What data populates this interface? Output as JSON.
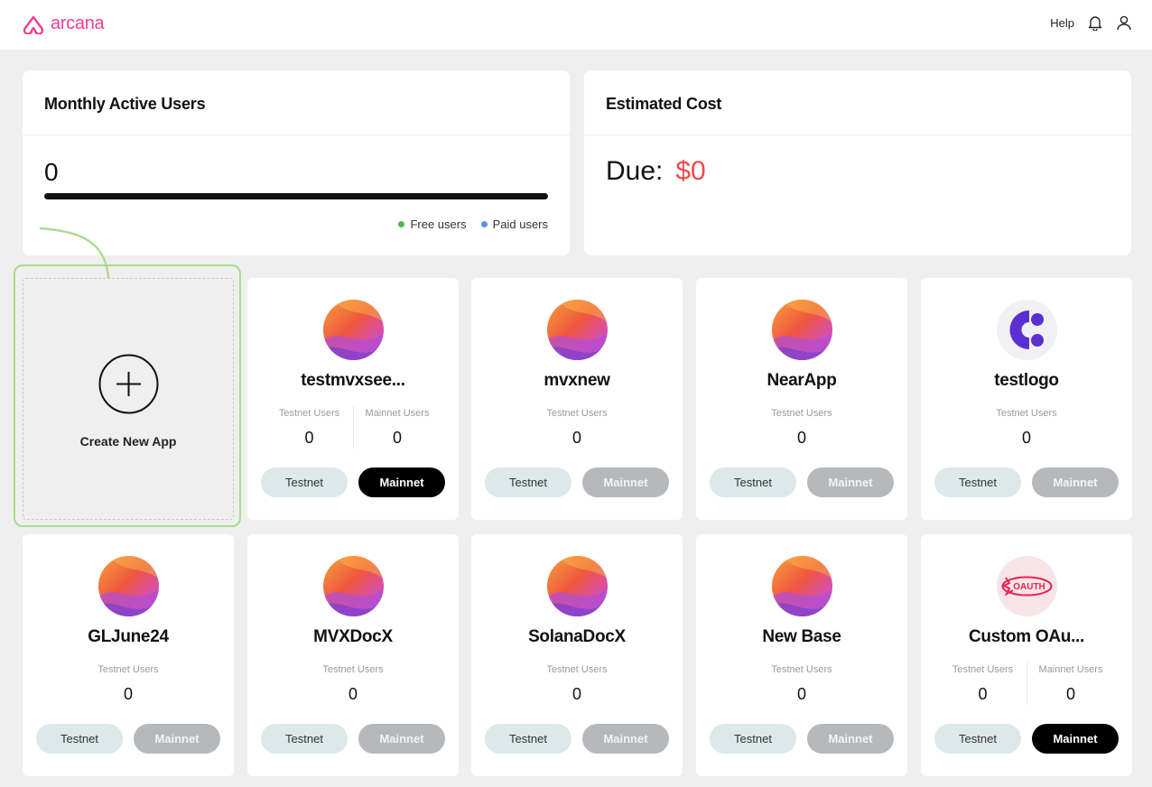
{
  "header": {
    "brand": "arcana",
    "help_label": "Help",
    "brand_color": "#ef3f8f"
  },
  "mau": {
    "title": "Monthly Active Users",
    "count": "0",
    "legend_free": "Free users",
    "legend_paid": "Paid users",
    "free_color": "#4cbb47",
    "paid_color": "#5b8def"
  },
  "cost": {
    "title": "Estimated Cost",
    "due_label": "Due:",
    "due_value": "$0"
  },
  "create": {
    "label": "Create New App"
  },
  "apps": [
    {
      "name": "testmvxsee...",
      "logo": "gradient",
      "testnet_label": "Testnet Users",
      "testnet_users": "0",
      "mainnet_label": "Mainnet Users",
      "mainnet_users": "0",
      "btn_testnet": "Testnet",
      "btn_mainnet": "Mainnet",
      "mainnet_enabled": true
    },
    {
      "name": "mvxnew",
      "logo": "gradient",
      "testnet_label": "Testnet Users",
      "testnet_users": "0",
      "btn_testnet": "Testnet",
      "btn_mainnet": "Mainnet",
      "mainnet_enabled": false
    },
    {
      "name": "NearApp",
      "logo": "gradient",
      "testnet_label": "Testnet Users",
      "testnet_users": "0",
      "btn_testnet": "Testnet",
      "btn_mainnet": "Mainnet",
      "mainnet_enabled": false
    },
    {
      "name": "testlogo",
      "logo": "c-logo",
      "testnet_label": "Testnet Users",
      "testnet_users": "0",
      "btn_testnet": "Testnet",
      "btn_mainnet": "Mainnet",
      "mainnet_enabled": false
    },
    {
      "name": "GLJune24",
      "logo": "gradient",
      "testnet_label": "Testnet Users",
      "testnet_users": "0",
      "btn_testnet": "Testnet",
      "btn_mainnet": "Mainnet",
      "mainnet_enabled": false
    },
    {
      "name": "MVXDocX",
      "logo": "gradient",
      "testnet_label": "Testnet Users",
      "testnet_users": "0",
      "btn_testnet": "Testnet",
      "btn_mainnet": "Mainnet",
      "mainnet_enabled": false
    },
    {
      "name": "SolanaDocX",
      "logo": "gradient",
      "testnet_label": "Testnet Users",
      "testnet_users": "0",
      "btn_testnet": "Testnet",
      "btn_mainnet": "Mainnet",
      "mainnet_enabled": false
    },
    {
      "name": "New Base",
      "logo": "gradient",
      "testnet_label": "Testnet Users",
      "testnet_users": "0",
      "btn_testnet": "Testnet",
      "btn_mainnet": "Mainnet",
      "mainnet_enabled": false
    },
    {
      "name": "Custom OAu...",
      "logo": "oauth-logo",
      "logo_text": "OAUTH",
      "testnet_label": "Testnet Users",
      "testnet_users": "0",
      "mainnet_label": "Mainnet Users",
      "mainnet_users": "0",
      "btn_testnet": "Testnet",
      "btn_mainnet": "Mainnet",
      "mainnet_enabled": true
    }
  ]
}
